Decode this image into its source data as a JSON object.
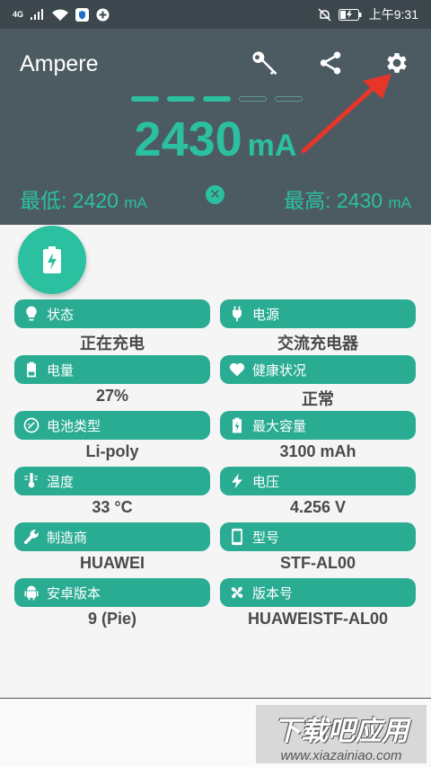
{
  "status": {
    "network": "4G",
    "time": "上午9:31"
  },
  "app": {
    "title": "Ampere"
  },
  "meter": {
    "current": "2430",
    "unit": "mA",
    "min_label": "最低: 2420",
    "max_label": "最高: 2430",
    "min_unit": "mA",
    "max_unit": "mA",
    "reset_glyph": "✕",
    "level_dots_active": 3,
    "level_dots_total": 5
  },
  "colors": {
    "accent": "#2bc0a0",
    "header": "#4c5b62",
    "pill": "#2aac93"
  },
  "info": [
    {
      "label": "状态",
      "value": "正在充电",
      "icon": "bulb-icon"
    },
    {
      "label": "电源",
      "value": "交流充电器",
      "icon": "plug-icon"
    },
    {
      "label": "电量",
      "value": "27%",
      "icon": "battery-icon"
    },
    {
      "label": "健康状况",
      "value": "正常",
      "icon": "heart-icon"
    },
    {
      "label": "电池类型",
      "value": "Li-poly",
      "icon": "battery-type-icon"
    },
    {
      "label": "最大容量",
      "value": "3100 mAh",
      "icon": "battery-charging-icon"
    },
    {
      "label": "温度",
      "value": "33 °C",
      "icon": "thermometer-icon"
    },
    {
      "label": "电压",
      "value": "4.256 V",
      "icon": "bolt-icon"
    },
    {
      "label": "制造商",
      "value": "HUAWEI",
      "icon": "wrench-icon"
    },
    {
      "label": "型号",
      "value": "STF-AL00",
      "icon": "phone-icon"
    },
    {
      "label": "安卓版本",
      "value": "9 (Pie)",
      "icon": "android-icon"
    },
    {
      "label": "版本号",
      "value": "HUAWEISTF-AL00",
      "icon": "fan-icon"
    }
  ],
  "watermark": {
    "line1": "下载吧应用",
    "line2": "www.xiazainiao.com"
  }
}
